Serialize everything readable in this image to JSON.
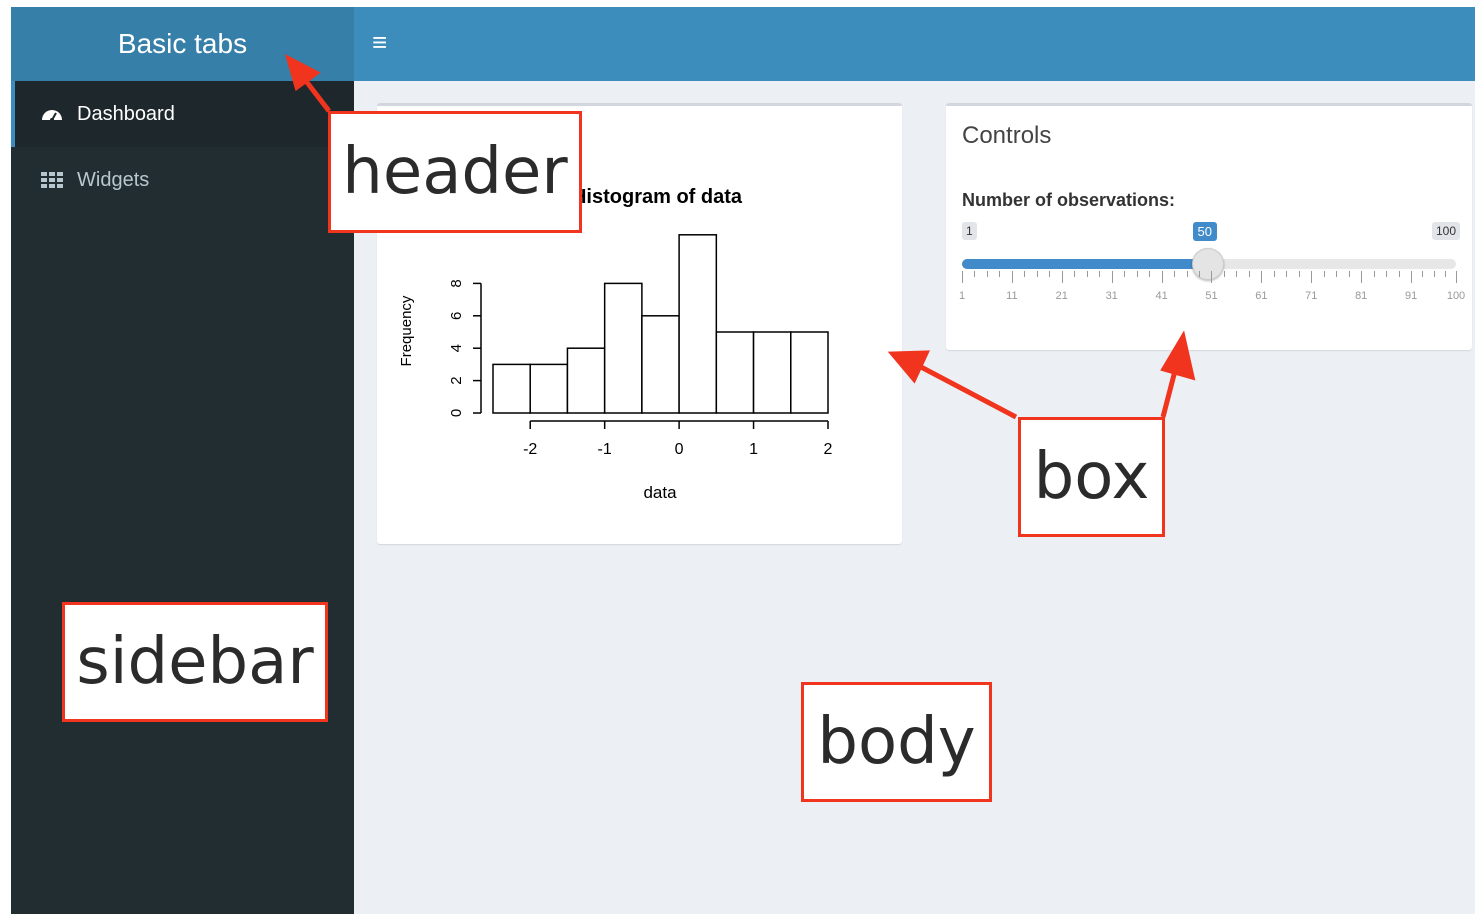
{
  "header": {
    "title": "Basic tabs",
    "toggle_icon": "hamburger-icon"
  },
  "sidebar": {
    "items": [
      {
        "label": "Dashboard",
        "icon": "dashboard-icon",
        "active": true
      },
      {
        "label": "Widgets",
        "icon": "table-grid-icon",
        "active": false
      }
    ]
  },
  "boxes": {
    "histogram": {
      "chart_data": {
        "type": "bar",
        "title": "Histogram of data",
        "xlabel": "data",
        "ylabel": "Frequency",
        "bins": [
          [
            -2.5,
            -2.0
          ],
          [
            -2.0,
            -1.5
          ],
          [
            -1.5,
            -1.0
          ],
          [
            -1.0,
            -0.5
          ],
          [
            -0.5,
            0.0
          ],
          [
            0.0,
            0.5
          ],
          [
            0.5,
            1.0
          ],
          [
            1.0,
            1.5
          ],
          [
            1.5,
            2.0
          ]
        ],
        "values": [
          3,
          3,
          4,
          8,
          6,
          11,
          5,
          5,
          5
        ],
        "x_ticks": [
          "-2",
          "-1",
          "0",
          "1",
          "2"
        ],
        "y_ticks": [
          "0",
          "2",
          "4",
          "6",
          "8"
        ],
        "xlim": [
          -2.5,
          2.0
        ],
        "ylim": [
          0,
          10
        ]
      }
    },
    "controls": {
      "title": "Controls",
      "slider": {
        "label": "Number of observations:",
        "min": 1,
        "max": 100,
        "value": 50,
        "min_label": "1",
        "max_label": "100",
        "value_label": "50",
        "grid_labels": [
          "1",
          "11",
          "21",
          "31",
          "41",
          "51",
          "61",
          "71",
          "81",
          "91",
          "100"
        ],
        "accent": "#428bca"
      }
    }
  },
  "annotations": {
    "header": "header",
    "sidebar": "sidebar",
    "box": "box",
    "body": "body",
    "color": "#f0341e"
  }
}
